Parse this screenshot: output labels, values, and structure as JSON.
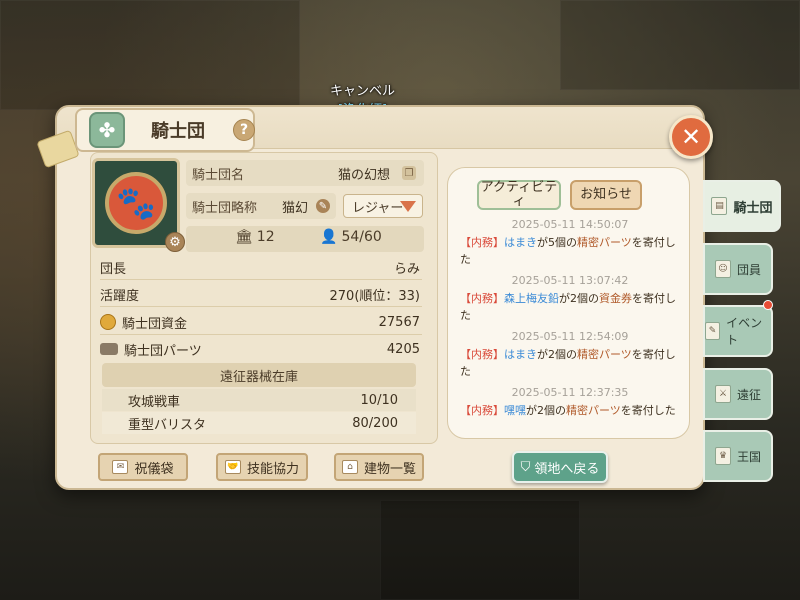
{
  "npc": {
    "name": "キャンベル",
    "role": "[浄化師]"
  },
  "header": {
    "title": "騎士団",
    "help": "?"
  },
  "guild": {
    "name_label": "騎士団名",
    "name_value": "猫の幻想",
    "short_label": "騎士団略称",
    "short_value": "猫幻",
    "rank_select": "レジャー",
    "buildings": "12",
    "members": "54/60"
  },
  "info": [
    {
      "label": "団長",
      "value": "らみ"
    },
    {
      "label": "活躍度",
      "value": "270(順位：33)"
    },
    {
      "label": "騎士団資金",
      "value": "27567"
    },
    {
      "label": "騎士団パーツ",
      "value": "4205"
    }
  ],
  "siege": {
    "header": "遠征器械在庫",
    "rows": [
      {
        "label": "攻城戦車",
        "value": "10/10"
      },
      {
        "label": "重型バリスタ",
        "value": "80/200"
      }
    ]
  },
  "log_tabs": {
    "activity": "アクティビティ",
    "notice": "お知らせ"
  },
  "log": [
    {
      "time": "2025-05-11 14:50:07",
      "tag": "【内務】",
      "who": "はまき",
      "mid": "が5個の",
      "item": "精密パーツ",
      "end": "を寄付した"
    },
    {
      "time": "2025-05-11 13:07:42",
      "tag": "【内務】",
      "who": "森上梅友鉛",
      "mid": "が2個の",
      "item": "資金券",
      "end": "を寄付した"
    },
    {
      "time": "2025-05-11 12:54:09",
      "tag": "【内務】",
      "who": "はまき",
      "mid": "が2個の",
      "item": "精密パーツ",
      "end": "を寄付した"
    },
    {
      "time": "2025-05-11 12:37:35",
      "tag": "【内務】",
      "who": "嘿嘿",
      "mid": "が2個の",
      "item": "精密パーツ",
      "end": "を寄付した"
    }
  ],
  "buttons": {
    "gift": "祝儀袋",
    "skill": "技能協力",
    "building": "建物一覧",
    "back": "領地へ戻る"
  },
  "side_tabs": [
    "騎士団",
    "団員",
    "イベント",
    "遠征",
    "王国"
  ],
  "colors": {
    "accent": "#5ea28a",
    "close": "#e06b3f",
    "highlight_name": "#3a8ad6",
    "tag": "#d94a3a"
  }
}
